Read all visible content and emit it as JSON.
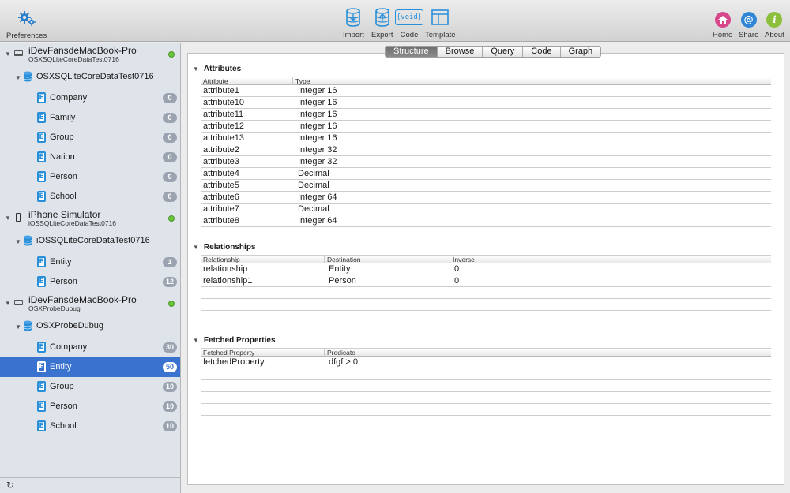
{
  "toolbar": {
    "preferences_label": "Preferences",
    "import_label": "Import",
    "export_label": "Export",
    "code_label": "Code",
    "code_icon_text": "{void}",
    "template_label": "Template",
    "home_label": "Home",
    "share_label": "Share",
    "share_icon_text": "@",
    "about_label": "About",
    "about_icon_text": "i"
  },
  "sidebar": {
    "groups": [
      {
        "device_name": "iDevFansdeMacBook-Pro",
        "device_sub": "OSXSQLiteCoreDataTest0716",
        "database": "OSXSQLiteCoreDataTest0716",
        "entities": [
          {
            "name": "Company",
            "count": "0"
          },
          {
            "name": "Family",
            "count": "0"
          },
          {
            "name": "Group",
            "count": "0"
          },
          {
            "name": "Nation",
            "count": "0"
          },
          {
            "name": "Person",
            "count": "0"
          },
          {
            "name": "School",
            "count": "0"
          }
        ]
      },
      {
        "device_name": "iPhone Simulator",
        "device_sub": "iOSSQLiteCoreDataTest0716",
        "database": "iOSSQLiteCoreDataTest0716",
        "entities": [
          {
            "name": "Entity",
            "count": "1"
          },
          {
            "name": "Person",
            "count": "12"
          }
        ]
      },
      {
        "device_name": "iDevFansdeMacBook-Pro",
        "device_sub": "OSXProbeDubug",
        "database": "OSXProbeDubug",
        "entities": [
          {
            "name": "Company",
            "count": "30"
          },
          {
            "name": "Entity",
            "count": "50"
          },
          {
            "name": "Group",
            "count": "10"
          },
          {
            "name": "Person",
            "count": "10"
          },
          {
            "name": "School",
            "count": "10"
          }
        ]
      }
    ],
    "selected": "Entity",
    "entity_icon_letter": "E",
    "refresh_icon": "↻"
  },
  "tabs": [
    "Structure",
    "Browse",
    "Query",
    "Code",
    "Graph"
  ],
  "active_tab": "Structure",
  "attributes": {
    "title": "Attributes",
    "headers": [
      "Attribute",
      "Type"
    ],
    "rows": [
      [
        "attribute1",
        "Integer 16"
      ],
      [
        "attribute10",
        "Integer 16"
      ],
      [
        "attribute11",
        "Integer 16"
      ],
      [
        "attribute12",
        "Integer 16"
      ],
      [
        "attribute13",
        "Integer 16"
      ],
      [
        "attribute2",
        "Integer 32"
      ],
      [
        "attribute3",
        "Integer 32"
      ],
      [
        "attribute4",
        "Decimal"
      ],
      [
        "attribute5",
        "Decimal"
      ],
      [
        "attribute6",
        "Integer 64"
      ],
      [
        "attribute7",
        "Decimal"
      ],
      [
        "attribute8",
        "Integer 64"
      ]
    ]
  },
  "relationships": {
    "title": "Relationships",
    "headers": [
      "Relationship",
      "Destination",
      "Inverse"
    ],
    "rows": [
      [
        "relationship",
        "Entity",
        "0"
      ],
      [
        "relationship1",
        "Person",
        "0"
      ]
    ]
  },
  "fetched": {
    "title": "Fetched Properties",
    "headers": [
      "Fetched Property",
      "Predicate"
    ],
    "rows": [
      [
        "fetchedProperty",
        "dfgf > 0"
      ]
    ]
  },
  "colors": {
    "accent": "#3a72cf",
    "entity_icon": "#2a8fd9",
    "status_online": "#6ac43c"
  }
}
